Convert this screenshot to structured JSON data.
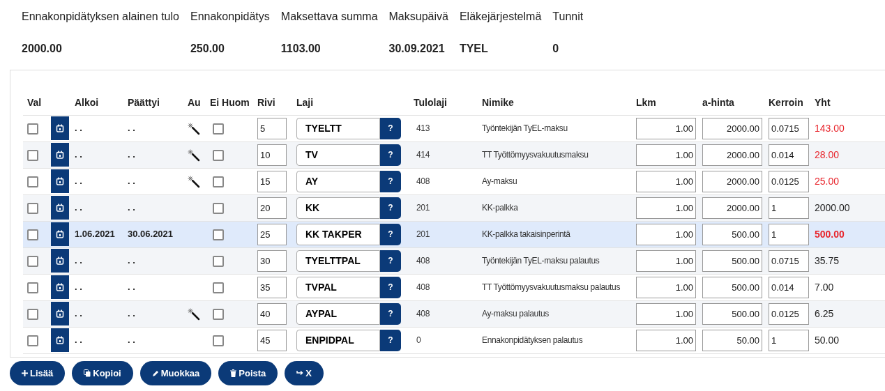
{
  "summary": [
    {
      "label": "Ennakonpidätyksen alainen tulo",
      "value": "2000.00"
    },
    {
      "label": "Ennakonpidätys",
      "value": "250.00"
    },
    {
      "label": "Maksettava summa",
      "value": "1103.00"
    },
    {
      "label": "Maksupäivä",
      "value": "30.09.2021"
    },
    {
      "label": "Eläkejärjestelmä",
      "value": "TYEL"
    },
    {
      "label": "Tunnit",
      "value": "0"
    }
  ],
  "table": {
    "columns": [
      "Val",
      "Alkoi",
      "Päättyi",
      "Au",
      "Ei Huom",
      "Rivi",
      "Laji",
      "Tulolaji",
      "Nimike",
      "Lkm",
      "a-hinta",
      "Kerroin",
      "Yht"
    ],
    "rows": [
      {
        "selected": false,
        "checked": false,
        "alkoi": ". .",
        "paattyi": ". .",
        "auto": true,
        "ei_huom": false,
        "rivi": "5",
        "laji": "TYELTT",
        "help": "?",
        "tulolaji": "413",
        "nimike": "Työntekijän TyEL-maksu",
        "lkm": "1.00",
        "a_hinta": {
          "value": "2000.00"
        },
        "kerroin": "0.0715",
        "yht": "143.00",
        "alert": true
      },
      {
        "selected": false,
        "checked": false,
        "alkoi": ". .",
        "paattyi": ". .",
        "auto": true,
        "ei_huom": false,
        "rivi": "10",
        "laji": "TV",
        "help": "?",
        "tulolaji": "414",
        "nimike": "TT Työttömyysvakuutusmaksu",
        "lkm": "1.00",
        "a_hinta": {
          "value": "2000.00"
        },
        "kerroin": "0.014",
        "yht": "28.00",
        "alert": true
      },
      {
        "selected": false,
        "checked": false,
        "alkoi": ". .",
        "paattyi": ". .",
        "auto": true,
        "ei_huom": false,
        "rivi": "15",
        "laji": "AY",
        "help": "?",
        "tulolaji": "408",
        "nimike": "Ay-maksu",
        "lkm": "1.00",
        "a_hinta": {
          "value": "2000.00"
        },
        "kerroin": "0.0125",
        "yht": "25.00",
        "alert": true
      },
      {
        "selected": false,
        "checked": false,
        "alkoi": ". .",
        "paattyi": ". .",
        "auto": false,
        "ei_huom": false,
        "rivi": "20",
        "laji": "KK",
        "help": "?",
        "tulolaji": "201",
        "nimike": "KK-palkka",
        "lkm": "1.00",
        "a_hinta": {
          "value": "2000.00"
        },
        "kerroin": "1",
        "yht": "2000.00",
        "alert": false
      },
      {
        "selected": true,
        "checked": false,
        "alkoi": "1.06.2021",
        "paattyi": "30.06.2021",
        "auto": false,
        "ei_huom": false,
        "rivi": "25",
        "laji": "KK TAKPER",
        "help": "?",
        "tulolaji": "201",
        "nimike": "KK-palkka takaisinperintä",
        "lkm": "1.00",
        "a_hinta": {
          "value": "500.00"
        },
        "kerroin": "1",
        "yht": "500.00",
        "alert": true
      },
      {
        "selected": false,
        "checked": false,
        "alkoi": ". .",
        "paattyi": ". .",
        "auto": false,
        "ei_huom": false,
        "rivi": "30",
        "laji": "TYELTTPAL",
        "help": "?",
        "tulolaji": "408",
        "nimike": "Työntekijän TyEL-maksu palautus",
        "lkm": "1.00",
        "a_hinta": {
          "value": "500.00"
        },
        "kerroin": "0.0715",
        "yht": "35.75",
        "alert": false
      },
      {
        "selected": false,
        "checked": false,
        "alkoi": ". .",
        "paattyi": ". .",
        "auto": false,
        "ei_huom": false,
        "rivi": "35",
        "laji": "TVPAL",
        "help": "?",
        "tulolaji": "408",
        "nimike": "TT Työttömyysvakuutusmaksu palautus",
        "lkm": "1.00",
        "a_hinta": {
          "value": "500.00"
        },
        "kerroin": "0.014",
        "yht": "7.00",
        "alert": false
      },
      {
        "selected": false,
        "checked": false,
        "alkoi": ". .",
        "paattyi": ". .",
        "auto": true,
        "ei_huom": false,
        "rivi": "40",
        "laji": "AYPAL",
        "help": "?",
        "tulolaji": "408",
        "nimike": "Ay-maksu palautus",
        "lkm": "1.00",
        "a_hinta": {
          "value": "500.00"
        },
        "kerroin": "0.0125",
        "yht": "6.25",
        "alert": false
      },
      {
        "selected": false,
        "checked": false,
        "alkoi": ". .",
        "paattyi": ". .",
        "auto": false,
        "ei_huom": false,
        "rivi": "45",
        "laji": "ENPIDPAL",
        "help": "?",
        "tulolaji": "0",
        "nimike": "Ennakonpidätyksen palautus",
        "lkm": "1.00",
        "a_hinta": {
          "value": "50.00"
        },
        "kerroin": "1",
        "yht": "50.00",
        "alert": false
      }
    ]
  },
  "buttons": [
    {
      "kind": "add",
      "label": "Lisää"
    },
    {
      "kind": "copy",
      "label": "Kopioi"
    },
    {
      "kind": "edit",
      "label": "Muokkaa"
    },
    {
      "kind": "delete",
      "label": "Poista"
    },
    {
      "kind": "exit",
      "label": "X"
    }
  ]
}
